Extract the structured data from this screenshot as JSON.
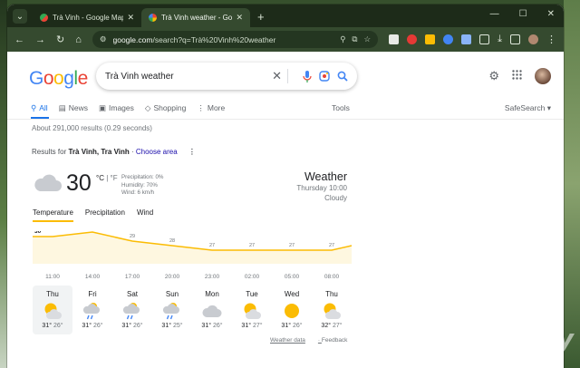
{
  "browser": {
    "tabs": [
      {
        "title": "Trà Vinh - Google Maps",
        "active": false
      },
      {
        "title": "Trà Vinh weather - Google Search",
        "active": true
      }
    ],
    "new_tab": "+",
    "url_host": "google.com",
    "url_path": "/search?q=Trà%20Vinh%20weather"
  },
  "search": {
    "logo": "Google",
    "query": "Trà Vinh weather"
  },
  "nav": {
    "items": [
      "All",
      "News",
      "Images",
      "Shopping",
      "More"
    ],
    "tools": "Tools",
    "safesearch": "SafeSearch"
  },
  "stats": "About 291,000 results (0.29 seconds)",
  "results_for": {
    "prefix": "Results for ",
    "place": "Trà Vinh, Tra Vinh",
    "sep": " · ",
    "link": "Choose area"
  },
  "weather": {
    "temp": "30",
    "unit_c": "°C",
    "unit_sep": " | ",
    "unit_f": "°F",
    "precipitation": "Precipitation: 0%",
    "humidity": "Humidity: 70%",
    "wind": "Wind: 6 km/h",
    "title": "Weather",
    "time": "Thursday 10:00",
    "condition": "Cloudy",
    "tabs": [
      "Temperature",
      "Precipitation",
      "Wind"
    ],
    "days": [
      {
        "name": "Thu",
        "icon": "partly-cloudy-icon",
        "hi": "31°",
        "lo": "26°"
      },
      {
        "name": "Fri",
        "icon": "rain-icon",
        "hi": "31°",
        "lo": "26°"
      },
      {
        "name": "Sat",
        "icon": "rain-icon",
        "hi": "31°",
        "lo": "26°"
      },
      {
        "name": "Sun",
        "icon": "rain-icon",
        "hi": "31°",
        "lo": "25°"
      },
      {
        "name": "Mon",
        "icon": "cloud-icon",
        "hi": "31°",
        "lo": "26°"
      },
      {
        "name": "Tue",
        "icon": "partly-cloudy-icon",
        "hi": "31°",
        "lo": "27°"
      },
      {
        "name": "Wed",
        "icon": "sun-icon",
        "hi": "31°",
        "lo": "26°"
      },
      {
        "name": "Thu",
        "icon": "partly-cloudy-icon",
        "hi": "32°",
        "lo": "27°"
      }
    ],
    "footer_link": "Weather data",
    "feedback": "Feedback"
  },
  "chart_data": {
    "type": "area",
    "x": [
      "11:00",
      "14:00",
      "17:00",
      "20:00",
      "23:00",
      "02:00",
      "05:00",
      "08:00"
    ],
    "values": [
      30,
      31,
      29,
      28,
      27,
      27,
      27,
      27
    ],
    "point_labels": [
      "30",
      "31",
      "29",
      "28",
      "27",
      "27",
      "27",
      "27"
    ],
    "ylim": [
      24,
      32
    ]
  },
  "watermark": "Webuy",
  "colors": {
    "accent": "#1a73e8",
    "chart_line": "#fbbc04",
    "chart_fill": "#fef7e0"
  }
}
